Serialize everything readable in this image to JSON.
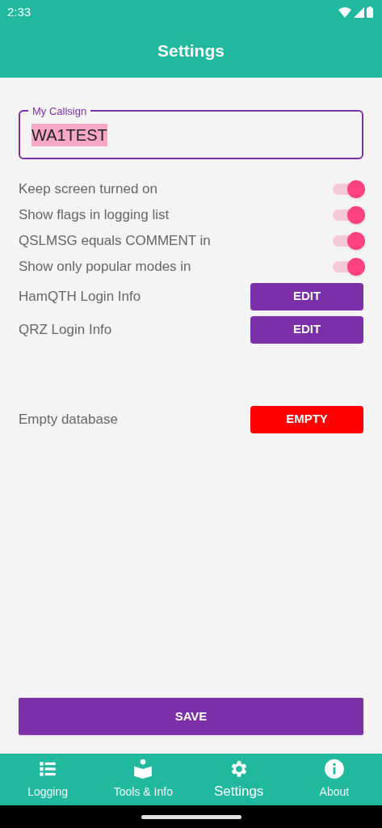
{
  "status_bar": {
    "time": "2:33"
  },
  "app_bar": {
    "title": "Settings"
  },
  "callsign": {
    "label": "My Callsign",
    "value": "WA1TEST",
    "focused": true
  },
  "settings": [
    {
      "kind": "toggle",
      "label": "Keep screen turned on",
      "on": true
    },
    {
      "kind": "toggle",
      "label": "Show flags in logging list",
      "on": true
    },
    {
      "kind": "toggle",
      "label": "QSLMSG equals COMMENT in",
      "on": true
    },
    {
      "kind": "toggle",
      "label": "Show only popular modes in",
      "on": true
    },
    {
      "kind": "button",
      "label": "HamQTH Login Info",
      "button": "EDIT",
      "color": "#7b2fa8"
    },
    {
      "kind": "button",
      "label": "QRZ Login Info",
      "button": "EDIT",
      "color": "#7b2fa8"
    }
  ],
  "danger": {
    "label": "Empty database",
    "button": "EMPTY",
    "color": "#ff0000"
  },
  "save_button": "SAVE",
  "bottom_nav": [
    {
      "label": "Logging",
      "selected": false
    },
    {
      "label": "Tools & Info",
      "selected": false
    },
    {
      "label": "Settings",
      "selected": true
    },
    {
      "label": "About",
      "selected": false
    }
  ]
}
